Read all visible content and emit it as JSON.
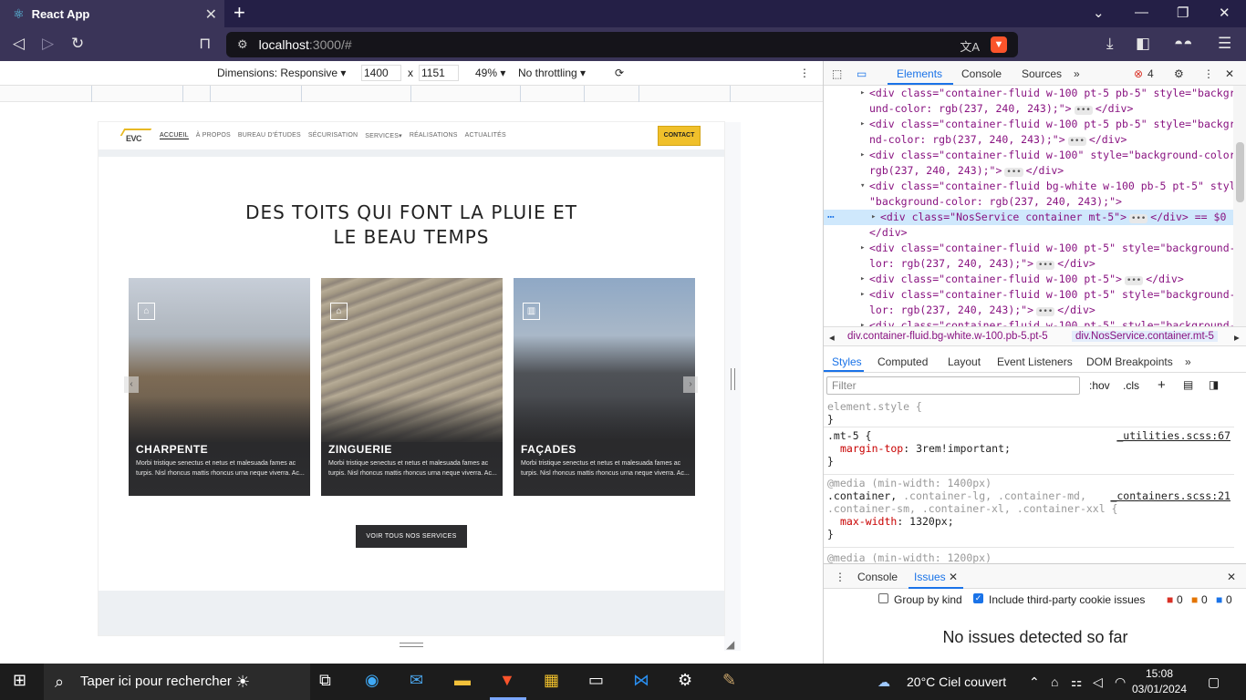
{
  "browser": {
    "tab_title": "React App",
    "url_host": "localhost",
    "url_rest": ":3000/#"
  },
  "device_toolbar": {
    "dimensions_label": "Dimensions: Responsive",
    "width": "1400",
    "times": "x",
    "height": "1151",
    "zoom": "49%",
    "throttling": "No throttling"
  },
  "site": {
    "nav": [
      "ACCUEIL",
      "À PROPOS",
      "BUREAU D'ÉTUDES",
      "SÉCURISATION",
      "SERVICES",
      "RÉALISATIONS",
      "ACTUALITÉS"
    ],
    "contact_label": "CONTACT",
    "logo_text": "EVC",
    "headline_line1": "DES TOITS QUI FONT LA PLUIE ET",
    "headline_line2": "LE BEAU TEMPS",
    "cards": [
      {
        "title": "CHARPENTE",
        "desc": "Morbi tristique senectus et netus et malesuada fames ac turpis. Nisl rhoncus mattis rhoncus urna neque viverra. Ac...",
        "color": "#8a7660"
      },
      {
        "title": "ZINGUERIE",
        "desc": "Morbi tristique senectus et netus et malesuada fames ac turpis. Nisl rhoncus mattis rhoncus urna neque viverra. Ac...",
        "color": "#b9a98a"
      },
      {
        "title": "FAÇADES",
        "desc": "Morbi tristique senectus et netus et malesuada fames ac turpis. Nisl rhoncus mattis rhoncus urna neque viverra. Ac...",
        "color": "#6f8aa8"
      }
    ],
    "all_services_label": "VOIR TOUS NOS SERVICES"
  },
  "devtools": {
    "tabs": [
      "Elements",
      "Console",
      "Sources"
    ],
    "error_count": "4",
    "dom_rows": [
      {
        "text": "<div class=\"container-fluid w-100 pt-5  pb-5\" style=\"backgro",
        "tri": "▸"
      },
      {
        "text": "und-color: rgb(237, 240, 243);\">",
        "tail": "</div>",
        "tri": ""
      },
      {
        "text": "<div class=\"container-fluid w-100 pt-5 pb-5\" style=\"backgrou",
        "tri": "▸"
      },
      {
        "text": "nd-color: rgb(237, 240, 243);\">",
        "tail": "</div>",
        "tri": ""
      },
      {
        "text": "<div class=\"container-fluid w-100\" style=\"background-color:",
        "tri": "▸"
      },
      {
        "text": "rgb(237, 240, 243);\">",
        "tail": "</div>",
        "tri": ""
      },
      {
        "text": "<div class=\"container-fluid bg-white w-100 pb-5 pt-5\" style=",
        "tri": "▾"
      },
      {
        "text": "\"background-color: rgb(237, 240, 243);\">",
        "tri": ""
      },
      {
        "text": "<div class=\"NosService container mt-5\">",
        "tail": "</div> == $0",
        "tri": "▸"
      },
      {
        "text": "</div>",
        "tri": ""
      },
      {
        "text": "<div class=\"container-fluid w-100 pt-5\" style=\"background-co",
        "tri": "▸"
      },
      {
        "text": "lor: rgb(237, 240, 243);\">",
        "tail": "</div>",
        "tri": ""
      },
      {
        "text": "<div class=\"container-fluid w-100 pt-5\">",
        "tail": "</div>",
        "tri": "▸"
      },
      {
        "text": "<div class=\"container-fluid w-100 pt-5\" style=\"background-co",
        "tri": "▸"
      },
      {
        "text": "lor: rgb(237, 240, 243);\">",
        "tail": "</div>",
        "tri": ""
      },
      {
        "text": "<div class=\"container-fluid w-100 pt-5\" style=\"background-co",
        "tri": "▸"
      }
    ],
    "crumb1": "div.container-fluid.bg-white.w-100.pb-5.pt-5",
    "crumb2": "div.NosService.container.mt-5",
    "style_tabs": [
      "Styles",
      "Computed",
      "Layout",
      "Event Listeners",
      "DOM Breakpoints"
    ],
    "filter_placeholder": "Filter",
    "hov": ":hov",
    "cls": ".cls",
    "styles": {
      "element_style": "element.style {",
      "close": "}",
      "mt5_sel": ".mt-5 {",
      "mt5_src": "_utilities.scss:67",
      "mt5_prop": "margin-top",
      "mt5_val": ": 3rem!important;",
      "media1400": "@media (min-width: 1400px)",
      "container_sel_a": ".container,",
      "container_sel_b": ".container-lg, .container-md,",
      "container_sel_c": ".container-sm, .container-xl, .container-xxl {",
      "container_src": "_containers.scss:21",
      "maxw_prop": "max-width",
      "maxw_val": ": 1320px;",
      "media1200": "@media (min-width: 1200px)"
    },
    "drawer_tabs": [
      "Console",
      "Issues"
    ],
    "group_by_kind": "Group by kind",
    "third_party": "Include third-party cookie issues",
    "issue_counts": [
      "0",
      "0",
      "0"
    ],
    "no_issues": "No issues detected so far"
  },
  "taskbar": {
    "search_placeholder": "Taper ici pour rechercher",
    "weather": "20°C  Ciel couvert",
    "time": "15:08",
    "date": "03/01/2024"
  }
}
